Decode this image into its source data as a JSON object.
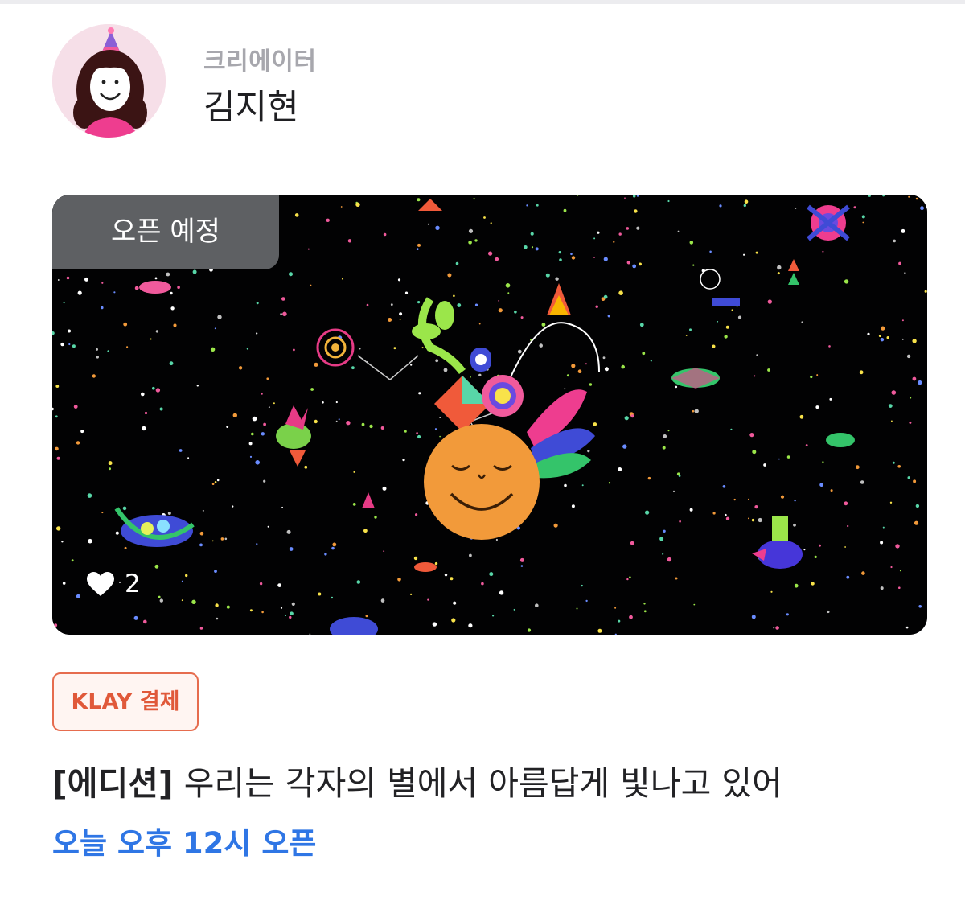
{
  "creator": {
    "role_label": "크리에이터",
    "name": "김지현"
  },
  "artwork": {
    "status_badge": "오픈 예정",
    "likes": "2",
    "icons": {
      "like": "heart-icon"
    }
  },
  "payment_chip": "KLAY 결제",
  "item": {
    "tag": "[에디션]",
    "title": "우리는 각자의 별에서 아름답게 빛나고 있어",
    "open_time": "오늘 오후 12시 오픈"
  },
  "colors": {
    "accent_blue": "#2f76e5",
    "chip_orange": "#e0593a",
    "badge_gray": "#5e6063"
  }
}
